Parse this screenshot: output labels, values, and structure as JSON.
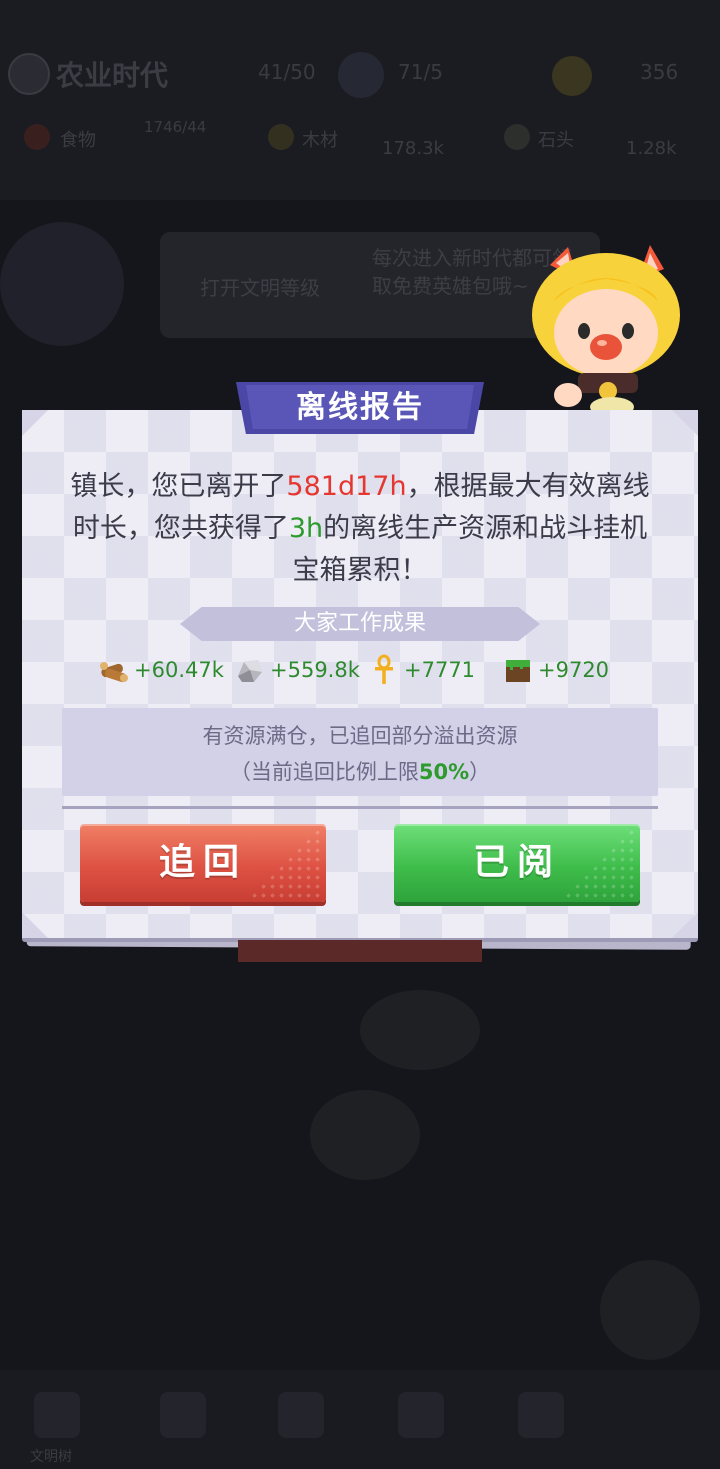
{
  "background": {
    "app_title": "农业时代",
    "stats": [
      "41/50",
      "71/5",
      "356"
    ],
    "resources": [
      {
        "name": "食物",
        "value": "1746/44"
      },
      {
        "name": "木材",
        "value": "178.3k"
      },
      {
        "name": "石头",
        "value": "1.28k"
      }
    ],
    "banner_left_text": "打开文明等级",
    "banner_right_text": "每次进入新时代都可领取免费英雄包哦~",
    "bottom_label": "文明树"
  },
  "dialog": {
    "title": "离线报告",
    "message": {
      "part1": "镇长，您已离开了",
      "duration": "581d17h",
      "part2": "，根据最大有效离线时长，您共获得了",
      "hours": "3h",
      "part3": "的离线生产资源和战斗挂机宝箱累积！"
    },
    "results_header": "大家工作成果",
    "results": [
      {
        "icon": "wood-icon",
        "value": "+60.47k"
      },
      {
        "icon": "stone-icon",
        "value": "+559.8k"
      },
      {
        "icon": "ankh-icon",
        "value": "+7771"
      },
      {
        "icon": "grass-block-icon",
        "value": "+9720"
      }
    ],
    "notice": {
      "line1": "有资源满仓，已追回部分溢出资源",
      "line2_prefix": "（当前追回比例上限",
      "line2_percent": "50%",
      "line2_suffix": "）"
    },
    "buttons": {
      "recover": "追回",
      "read": "已阅"
    }
  },
  "colors": {
    "highlight_red": "#e5372f",
    "highlight_green": "#2d9a2d",
    "title_ribbon": "#4b47a6",
    "button_red": "#de5244",
    "button_green": "#3fbd4b"
  }
}
